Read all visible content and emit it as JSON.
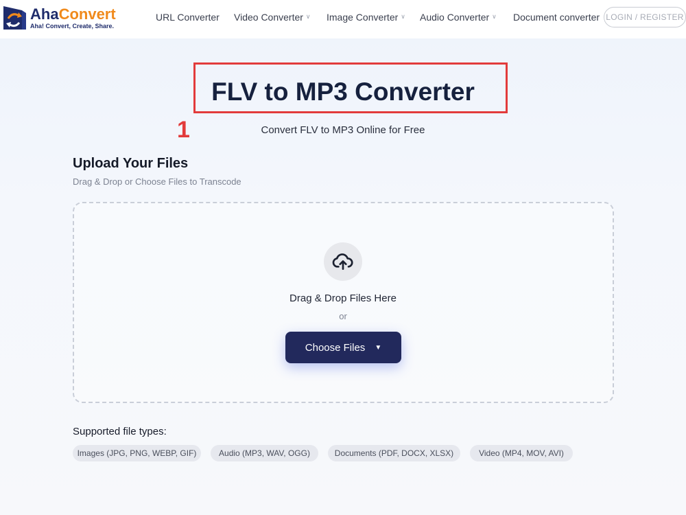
{
  "header": {
    "logo": {
      "name_part1": "Aha",
      "name_part2": "Convert",
      "tagline": "Aha! Convert, Create, Share."
    },
    "nav": [
      {
        "label": "URL Converter",
        "dropdown": false
      },
      {
        "label": "Video Converter",
        "dropdown": true
      },
      {
        "label": "Image Converter",
        "dropdown": true
      },
      {
        "label": "Audio Converter",
        "dropdown": true
      },
      {
        "label": "Document converter",
        "dropdown": false
      }
    ],
    "login_label": "LOGIN / REGISTER"
  },
  "hero": {
    "title": "FLV to MP3 Converter",
    "annotation_number": "1",
    "subtitle": "Convert FLV to MP3 Online for Free"
  },
  "upload": {
    "title": "Upload Your Files",
    "subtitle": "Drag & Drop or Choose Files to Transcode",
    "drop_text": "Drag & Drop Files Here",
    "or_text": "or",
    "choose_label": "Choose Files",
    "choose_caret": "▼"
  },
  "supported": {
    "label": "Supported file types:",
    "types": [
      "Images (JPG, PNG, WEBP, GIF)",
      "Audio (MP3, WAV, OGG)",
      "Documents (PDF, DOCX, XLSX)",
      "Video (MP4, MOV, AVI)"
    ]
  },
  "icons": {
    "logo": "logo-mark-icon",
    "upload": "cloud-upload-icon",
    "dropdown": "chevron-down-icon"
  },
  "colors": {
    "brand_dark": "#1f2c6b",
    "brand_orange": "#f08a1c",
    "annotation_red": "#e23b3b",
    "button": "#22295c"
  }
}
